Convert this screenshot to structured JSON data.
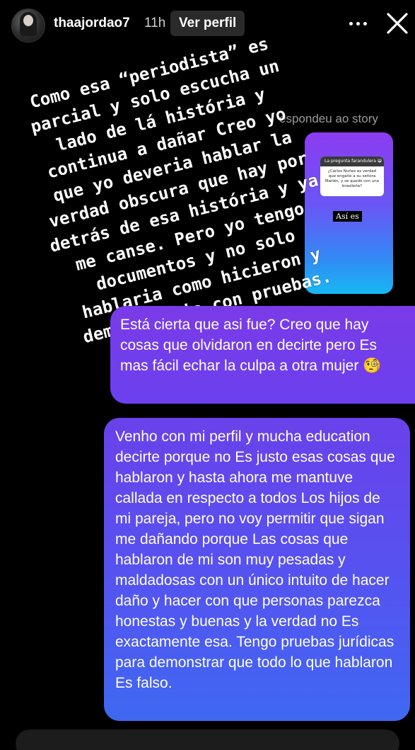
{
  "header": {
    "username": "thaajordao7",
    "time": "11h",
    "profile_button": "Ver perfil",
    "more_icon": "more-horizontal-icon",
    "close_icon": "close-icon"
  },
  "story_reply": {
    "label": "espondeu ao story",
    "question_card": {
      "header": "La pregunta farandulera 😁",
      "question": "¿Carlos Nuñez es verdad que engañó a su señora Marlén, y se quedó con una brasileña?"
    },
    "answer": "Así es"
  },
  "overlay_text": "Como esa “periodista” es\nparcial y solo escucha un\nlado de lá história y\ncontinua a dañar Creo yo\nque yo deveria hablar la\nverdad obscura que hay por\ndetrás de esa história y ya\nme canse. Pero yo tengo\ndocumentos y no solo\nhablaria como hicieron y\ndemonstraria con pruebas.",
  "messages": [
    {
      "text": "Está cierta que asi fue? Creo que hay cosas que olvidaron en decirte pero Es mas fácil echar la culpa a otra mujer 🧐"
    },
    {
      "text": "Venho con mi perfil y mucha education decirte porque no Es justo esas cosas que hablaron y hasta ahora me mantuve callada en respecto a todos Los hijos de mi pareja, pero no voy permitir que sigan me dañando porque Las cosas que hablaron de mi son muy pesadas y maldadosas con un único intuito de hacer daño y hacer con que personas parezca honestas y buenas y la verdad no Es exactamente esa. Tengo pruebas jurídicas para demonstrar que todo lo que hablaron Es falso."
    }
  ],
  "colors": {
    "background": "#000000",
    "bubble_top": "#7a3be8",
    "bubble_bottom": "#3f68f2"
  }
}
